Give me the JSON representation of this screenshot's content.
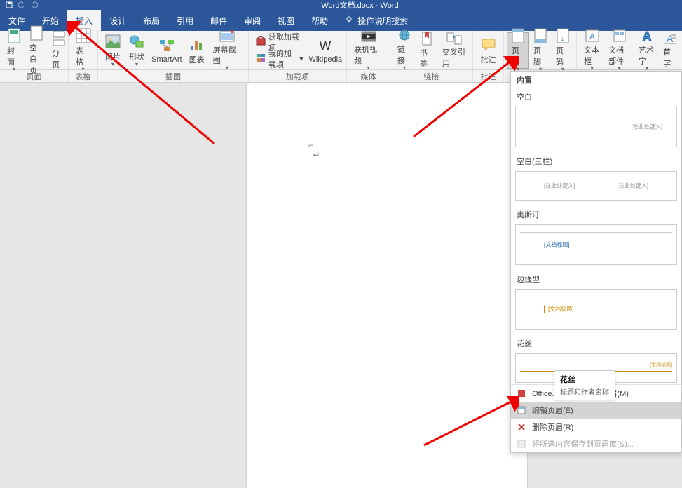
{
  "title_bar": {
    "doc_title": "Word文档.docx - Word"
  },
  "menus": {
    "file": "文件",
    "home": "开始",
    "insert": "插入",
    "design": "设计",
    "layout": "布局",
    "references": "引用",
    "mailings": "邮件",
    "review": "审阅",
    "view": "视图",
    "help": "帮助",
    "search": "操作说明搜索"
  },
  "ribbon": {
    "cover": "封面",
    "blank_page": "空白页",
    "page_break": "分页",
    "table": "表格",
    "picture": "图片",
    "shapes": "形状",
    "smartart": "SmartArt",
    "chart": "图表",
    "screenshot": "屏幕截图",
    "get_addins": "获取加载项",
    "my_addins": "我的加载项",
    "wikipedia": "Wikipedia",
    "online_video": "联机视频",
    "links": "链接",
    "bookmark": "书签",
    "cross_ref": "交叉引用",
    "comment": "批注",
    "header": "页眉",
    "footer": "页脚",
    "page_num": "页码",
    "textbox": "文本框",
    "doc_parts": "文档部件",
    "wordart": "艺术字",
    "dropcap": "首字"
  },
  "groups": {
    "pages": "页面",
    "tables": "表格",
    "illustrations": "插图",
    "addins": "加载项",
    "media": "媒体",
    "links": "链接",
    "comments": "批注",
    "header_footer": "",
    "text": ""
  },
  "dropdown": {
    "builtin": "内置",
    "blank": "空白",
    "blank_label": "[在此处键入]",
    "blank3": "空白(三栏)",
    "blank3_l1": "[在此处键入]",
    "blank3_l2": "[在此处键入]",
    "austin": "奥斯汀",
    "austin_label": "[文档标题]",
    "border": "边线型",
    "border_label": "[文档标题]",
    "filigree": "花丝",
    "filigree_label": "[文档标题]",
    "more_office": "Office.com 中的其他页眉(M)",
    "edit_header": "编辑页眉(E)",
    "remove_header": "删除页眉(R)",
    "save_gallery": "将所选内容保存到页眉库(S)..."
  },
  "tooltip": {
    "title": "花丝",
    "sub": "标题和作者名称"
  }
}
